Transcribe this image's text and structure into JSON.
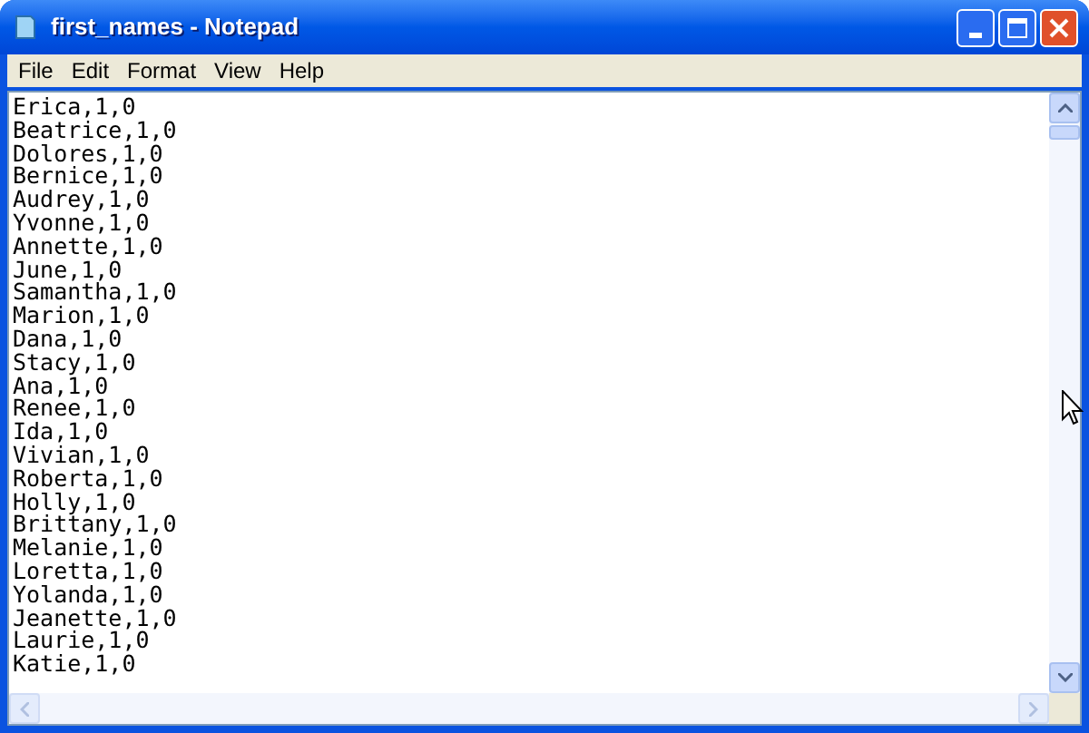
{
  "window": {
    "title": "first_names - Notepad"
  },
  "menu": [
    "File",
    "Edit",
    "Format",
    "View",
    "Help"
  ],
  "lines": [
    "Erica,1,0",
    "Beatrice,1,0",
    "Dolores,1,0",
    "Bernice,1,0",
    "Audrey,1,0",
    "Yvonne,1,0",
    "Annette,1,0",
    "June,1,0",
    "Samantha,1,0",
    "Marion,1,0",
    "Dana,1,0",
    "Stacy,1,0",
    "Ana,1,0",
    "Renee,1,0",
    "Ida,1,0",
    "Vivian,1,0",
    "Roberta,1,0",
    "Holly,1,0",
    "Brittany,1,0",
    "Melanie,1,0",
    "Loretta,1,0",
    "Yolanda,1,0",
    "Jeanette,1,0",
    "Laurie,1,0",
    "Katie,1,0"
  ]
}
